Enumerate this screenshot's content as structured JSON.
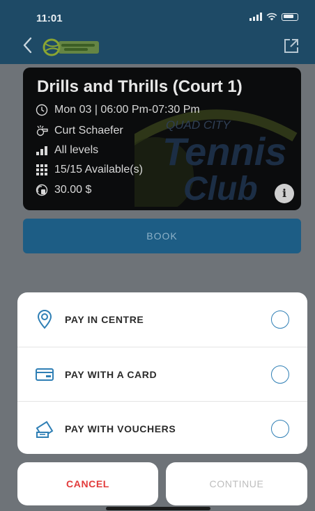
{
  "status_bar": {
    "time": "11:01"
  },
  "nav": {
    "logo_alt": "Tennis Club"
  },
  "event": {
    "title": "Drills and Thrills (Court 1)",
    "datetime": "Mon 03 | 06:00 Pm-07:30 Pm",
    "coach": "Curt Schaefer",
    "level": "All levels",
    "availability": "15/15 Available(s)",
    "price": "30.00 $",
    "info_label": "i",
    "background_logo": {
      "line1": "QUAD CITY",
      "line2": "Tennis",
      "line3": "Club"
    }
  },
  "book_button": {
    "label": "BOOK"
  },
  "payment_options": [
    {
      "label": "PAY IN CENTRE",
      "icon": "location-pin-icon"
    },
    {
      "label": "PAY WITH A CARD",
      "icon": "credit-card-icon"
    },
    {
      "label": "PAY WITH VOUCHERS",
      "icon": "voucher-icon"
    }
  ],
  "actions": {
    "cancel_label": "CANCEL",
    "continue_label": "CONTINUE"
  },
  "colors": {
    "accent": "#2f7fb5",
    "cancel": "#e23b3b",
    "disabled": "#bdbdbd",
    "header": "#1e4a66"
  }
}
